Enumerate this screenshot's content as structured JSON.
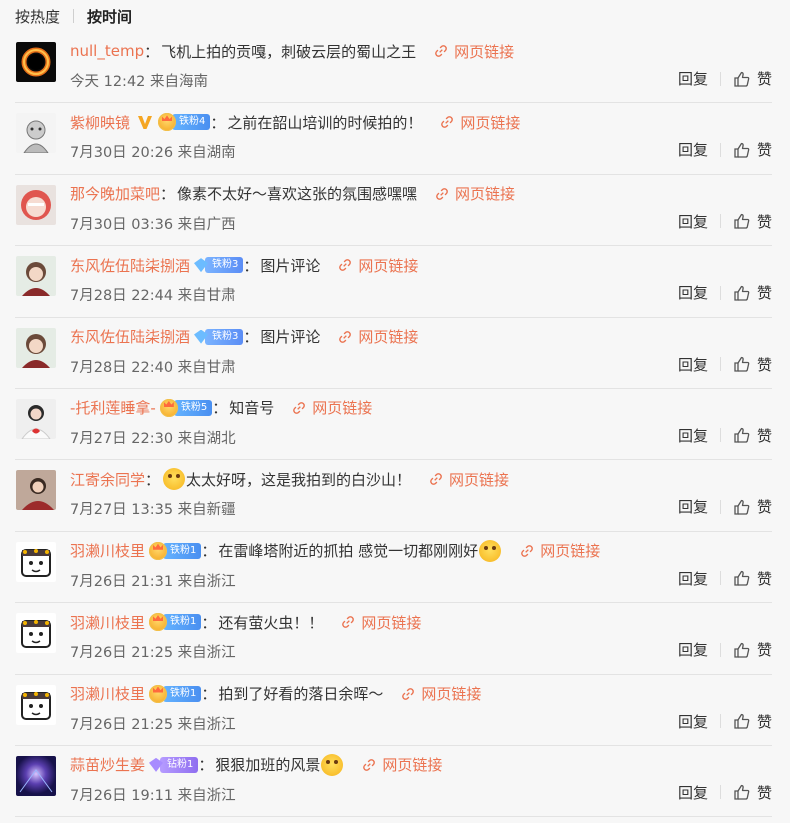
{
  "sort": {
    "hot": "按热度",
    "time": "按时间"
  },
  "actions": {
    "reply": "回复",
    "like": "赞"
  },
  "colors": {
    "username": "#eb7350",
    "link": "#eb7350"
  },
  "comments": [
    {
      "user": "null_temp",
      "badge": null,
      "text": "飞机上拍的贡嘎，刺破云层的蜀山之王",
      "link": "网页链接",
      "meta": "今天 12:42 来自海南",
      "avatar": "black-hole-avatar"
    },
    {
      "user": "紫柳映镜",
      "verified": true,
      "badge": "铁粉4",
      "text": "之前在韶山培训的时候拍的！",
      "link": "网页链接",
      "meta": "7月30日 20:26 来自湖南",
      "avatar": "sketch-avatar"
    },
    {
      "user": "那今晚加菜吧",
      "badge": null,
      "text": "像素不太好～喜欢这张的氛围感嘿嘿",
      "link": "网页链接",
      "meta": "7月30日 03:36 来自广西",
      "avatar": "red-hair-avatar"
    },
    {
      "user": "东风佐伍陆柒捌酒",
      "badge": "铁粉3",
      "badgeType": "diamond",
      "text": "图片评论",
      "link": "网页链接",
      "meta": "7月28日 22:44 来自甘肃",
      "avatar": "anime-girl-avatar"
    },
    {
      "user": "东风佐伍陆柒捌酒",
      "badge": "铁粉3",
      "badgeType": "diamond",
      "text": "图片评论",
      "link": "网页链接",
      "meta": "7月28日 22:40 来自甘肃",
      "avatar": "anime-girl-avatar"
    },
    {
      "user": "-托利莲睡拿-",
      "badge": "铁粉5",
      "text": "知音号",
      "link": "网页链接",
      "meta": "7月27日 22:30 来自湖北",
      "avatar": "girl-sweater-avatar"
    },
    {
      "user": "江寄余同学",
      "badge": null,
      "emoji": "crying-emoji",
      "text": "太太好呀，这是我拍到的白沙山！",
      "link": "网页链接",
      "meta": "7月27日 13:35 来自新疆",
      "avatar": "portrait-avatar"
    },
    {
      "user": "羽濑川枝里",
      "badge": "铁粉1",
      "text": "在雷峰塔附近的抓拍 感觉一切都刚刚好",
      "emojiAfter": "happy-emoji",
      "link": "网页链接",
      "meta": "7月26日 21:31 来自浙江",
      "avatar": "cartoon-avatar"
    },
    {
      "user": "羽濑川枝里",
      "badge": "铁粉1",
      "text": "还有萤火虫！！",
      "link": "网页链接",
      "meta": "7月26日 21:25 来自浙江",
      "avatar": "cartoon-avatar"
    },
    {
      "user": "羽濑川枝里",
      "badge": "铁粉1",
      "text": "拍到了好看的落日余晖～",
      "link": "网页链接",
      "meta": "7月26日 21:25 来自浙江",
      "avatar": "cartoon-avatar"
    },
    {
      "user": "蒜苗炒生姜",
      "badge": "钻粉1",
      "badgeType": "purple",
      "text": "狠狠加班的风景",
      "emojiAfter": "shocked-emoji",
      "link": "网页链接",
      "meta": "7月26日 19:11 来自浙江",
      "avatar": "galaxy-avatar"
    }
  ]
}
